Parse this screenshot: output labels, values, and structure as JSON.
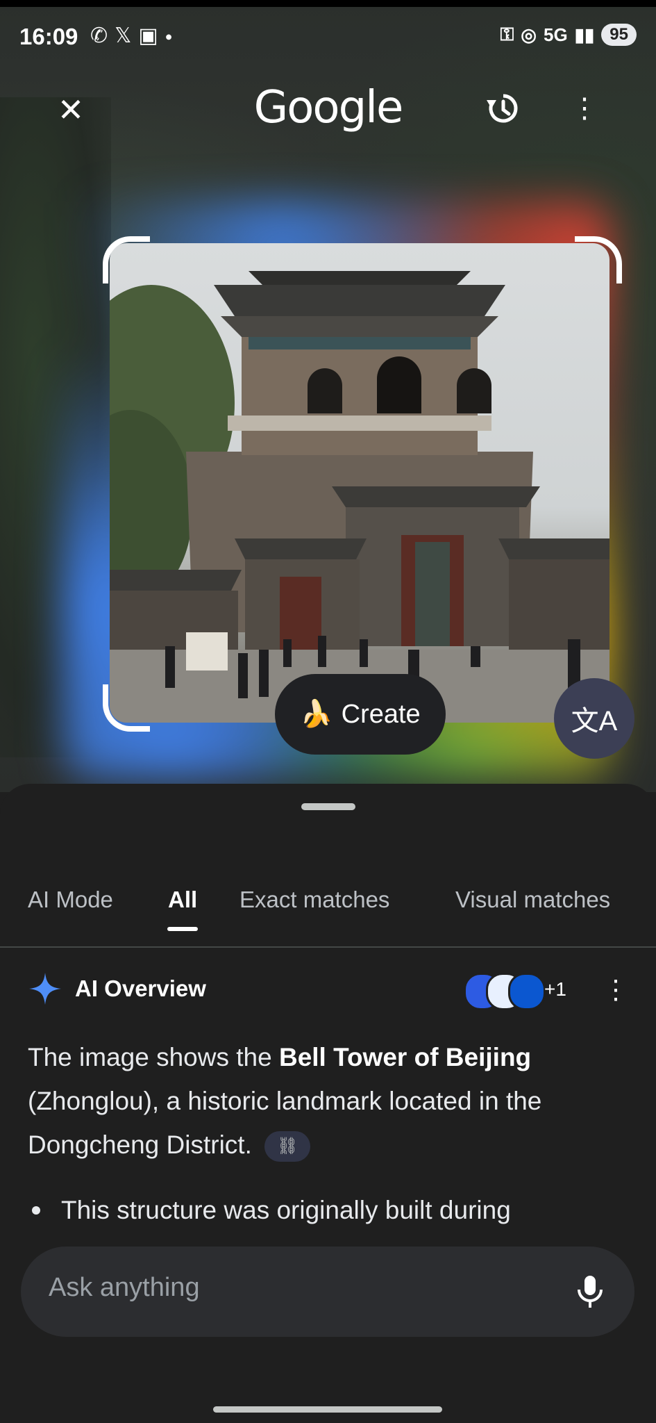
{
  "status_bar": {
    "time": "16:09",
    "left_icons": [
      "whatsapp-icon",
      "x-icon",
      "screenshot-icon",
      "dot-icon"
    ],
    "network": "5G",
    "battery": "95"
  },
  "header": {
    "logo_text": "Google",
    "close_icon": "close-icon",
    "history_icon": "history-icon",
    "more_icon": "more-vert-icon"
  },
  "image_actions": {
    "create_emoji": "🍌",
    "create_label": "Create",
    "translate_icon": "translate-icon",
    "translate_glyph": "文A"
  },
  "tabs": [
    {
      "label": "AI Mode",
      "active": false
    },
    {
      "label": "All",
      "active": true
    },
    {
      "label": "Exact matches",
      "active": false
    },
    {
      "label": "Visual matches",
      "active": false
    }
  ],
  "ai_overview": {
    "title": "AI Overview",
    "sources_count": "+1",
    "sources_colors": [
      "#2d5be3",
      "#1a73e8",
      "#0b57d0"
    ],
    "text_before": "The image shows the ",
    "text_bold": "Bell Tower of Beijing",
    "text_after": " (Zhonglou), a historic landmark located in the Dongcheng District.",
    "link_glyph": "🔗",
    "bullet": "This structure was originally built during"
  },
  "ask": {
    "placeholder": "Ask anything"
  },
  "colors": {
    "google_blue": "#4285F4",
    "google_red": "#EA4335",
    "google_yellow": "#FBBC05",
    "google_green": "#34A853",
    "sheet_bg": "#1f1f1f"
  }
}
